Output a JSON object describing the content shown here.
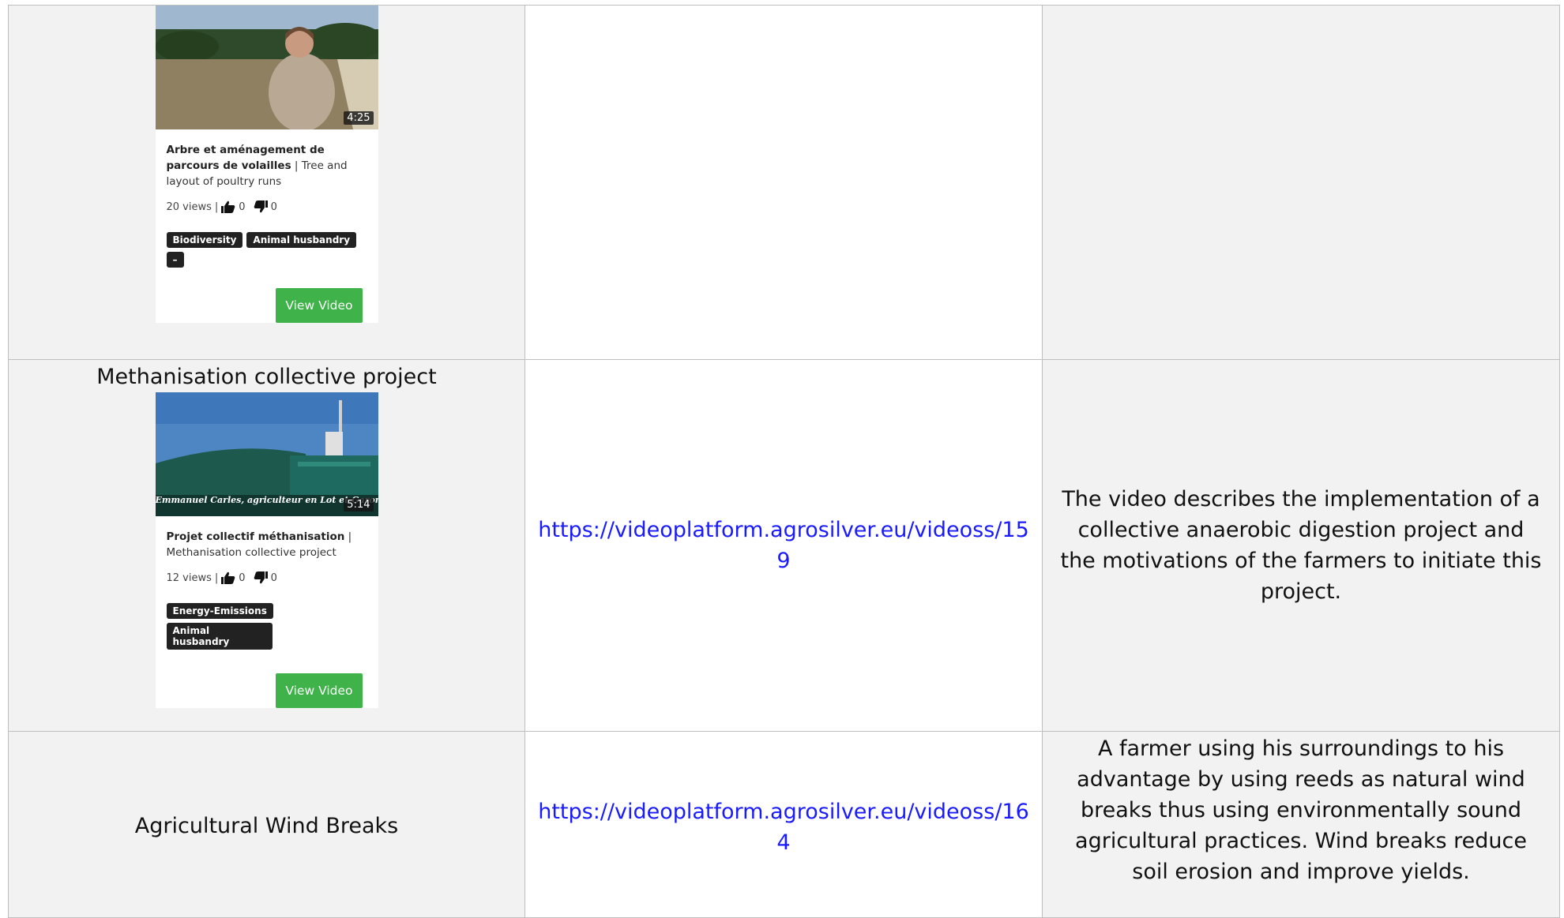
{
  "rows": [
    {
      "card": {
        "duration": "4:25",
        "title_bold": "Arbre et aménagement de parcours de volailles",
        "title_rest": " | Tree and layout of poultry runs",
        "views": "20 views",
        "sep": "|",
        "likes": "0",
        "dislikes": "0",
        "tags": [
          "Biodiversity",
          "Animal husbandry",
          "–"
        ],
        "button": "View Video"
      }
    },
    {
      "title": "Methanisation collective project",
      "card": {
        "duration": "5:14",
        "caption": "Emmanuel Carles, agriculteur en Lot et Garonne",
        "title_bold": "Projet collectif méthanisation",
        "title_rest": " | Methanisation collective project",
        "views": "12 views",
        "sep": "|",
        "likes": "0",
        "dislikes": "0",
        "tags": [
          "Energy-Emissions",
          "Animal husbandry"
        ],
        "button": "View Video"
      },
      "link": "https://videoplatform.agrosilver.eu/videoss/159",
      "description": "The video describes the implementation of a collective anaerobic digestion project and the motivations of the farmers to initiate this project."
    },
    {
      "title": "Agricultural Wind Breaks",
      "link": "https://videoplatform.agrosilver.eu/videoss/164",
      "description": "A farmer using his surroundings to his advantage by using reeds as natural wind breaks thus using environmentally sound agricultural practices. Wind breaks reduce soil erosion and improve yields."
    }
  ],
  "colors": {
    "button": "#3fb24a",
    "link": "#1a1aff",
    "cell_bg": "#f2f2f2",
    "tag_bg": "#222222"
  }
}
